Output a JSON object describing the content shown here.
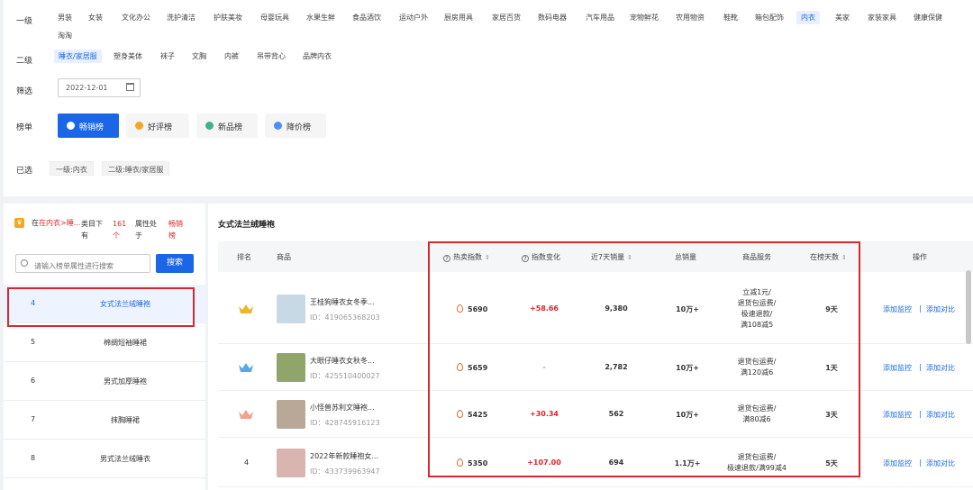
{
  "filters": {
    "level1_label": "一级",
    "level1_items": [
      "男装",
      "女装",
      "文化办公",
      "洗护清洁",
      "护肤美妆",
      "母婴玩具",
      "水果生鲜",
      "食品酒饮",
      "运动户外",
      "厨房用具",
      "家居百货",
      "数码电器",
      "汽车用品",
      "宠物鲜花",
      "农用物资",
      "鞋靴",
      "箱包配饰",
      "内衣",
      "美家",
      "家装家具",
      "健康保健",
      "淘淘"
    ],
    "level1_active": "内衣",
    "level2_label": "二级",
    "level2_items": [
      "睡衣/家居服",
      "塑身美体",
      "袜子",
      "文胸",
      "内裤",
      "吊带背心",
      "品牌内衣"
    ],
    "level2_active": "睡衣/家居服",
    "screen_label": "筛选",
    "date_value": "2022-12-01",
    "ranking_label": "榜单",
    "ranking_tabs": [
      "畅销榜",
      "好评榜",
      "新品榜",
      "降价榜"
    ],
    "ranking_active": "畅销榜",
    "selected_label": "已选",
    "selected_tags": [
      "一级:内衣",
      "二级:睡衣/家居服"
    ]
  },
  "left": {
    "hint": {
      "p1": "在内衣>睡...",
      "p2": "类目下有",
      "count": "161个",
      "p3": "属性处于",
      "p4": "畅销榜"
    },
    "search_placeholder": "请输入榜单属性进行搜索",
    "search_button": "搜索",
    "rows": [
      {
        "num": "4",
        "title": "女式法兰绒睡袍",
        "active": true
      },
      {
        "num": "5",
        "title": "棉绸短袖睡裙",
        "active": false
      },
      {
        "num": "6",
        "title": "男式加厚睡袍",
        "active": false
      },
      {
        "num": "7",
        "title": "抹胸睡裙",
        "active": false
      },
      {
        "num": "8",
        "title": "男式法兰绒睡衣",
        "active": false
      }
    ]
  },
  "main": {
    "title": "女式法兰绒睡袍",
    "columns": {
      "rank": "排名",
      "product": "商品",
      "heat": "热卖指数",
      "change": "指数变化",
      "sales7": "近7天销量",
      "total": "总销量",
      "service": "商品服务",
      "days": "在榜天数",
      "ops": "操作"
    },
    "rows": [
      {
        "rank": "",
        "crown": "gold",
        "name": "王桂狗睡衣女冬季...",
        "id": "ID：419065368203",
        "heat": "5690",
        "change": "+58.66",
        "sales7": "9,380",
        "total": "10万+",
        "service": [
          "立减1元/",
          "退货包运费/",
          "极速退款/",
          "满108减5"
        ],
        "days": "9天"
      },
      {
        "rank": "",
        "crown": "silver",
        "name": "大眼仔睡衣女秋冬...",
        "id": "ID：425510400027",
        "heat": "5659",
        "change": "-",
        "sales7": "2,782",
        "total": "10万+",
        "service": [
          "退货包运费/",
          "满120减6"
        ],
        "days": "1天"
      },
      {
        "rank": "",
        "crown": "bronze",
        "name": "小怪兽苏利文睡袍...",
        "id": "ID：428745916123",
        "heat": "5425",
        "change": "+30.34",
        "sales7": "562",
        "total": "10万+",
        "service": [
          "退货包运费/",
          "满80减6"
        ],
        "days": "3天"
      },
      {
        "rank": "4",
        "crown": "",
        "name": "2022年新款睡袍女...",
        "id": "ID：433739963947",
        "heat": "5350",
        "change": "+107.00",
        "sales7": "694",
        "total": "1.1万+",
        "service": [
          "退货包运费/",
          "极速退款/满99减4"
        ],
        "days": "5天"
      }
    ],
    "op_monitor": "添加监控",
    "op_sep": "|",
    "op_compare": "添加对比"
  },
  "colors": {
    "accent": "#1a66e6",
    "highlight_box": "#d9272e",
    "positive_change": "#d9272e",
    "gold_crown": "#f0b429",
    "silver_crown": "#5aa9e6",
    "bronze_crown": "#f3a28b"
  }
}
